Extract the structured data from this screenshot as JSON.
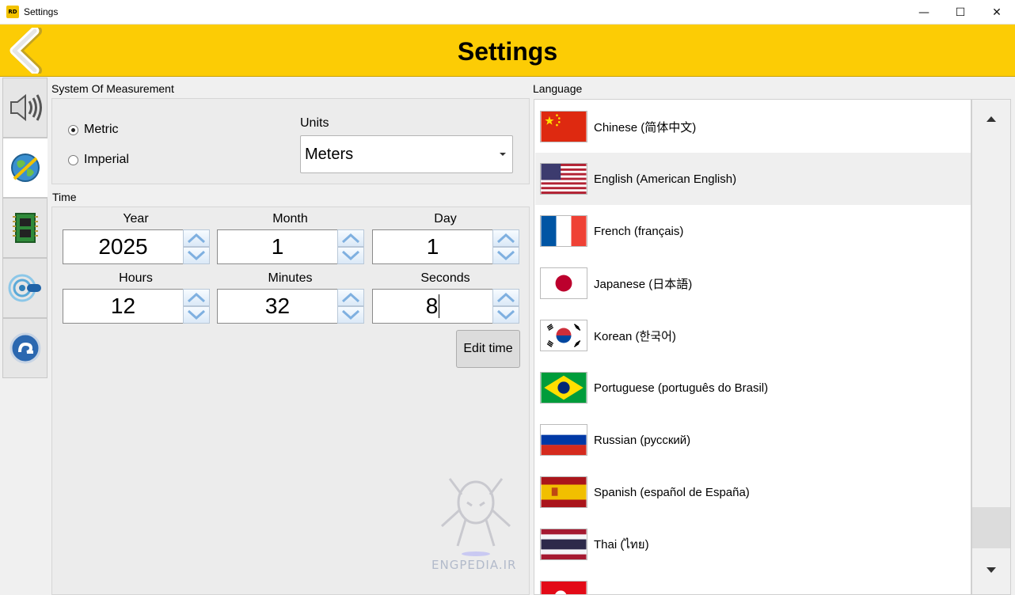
{
  "window": {
    "title": "Settings",
    "app_icon_text": "RD",
    "min_glyph": "—",
    "max_glyph": "☐",
    "close_glyph": "✕"
  },
  "header": {
    "title": "Settings"
  },
  "measurement": {
    "group_title": "System Of Measurement",
    "options": [
      {
        "label": "Metric",
        "selected": true
      },
      {
        "label": "Imperial",
        "selected": false
      }
    ],
    "units_label": "Units",
    "units_value": "Meters"
  },
  "time": {
    "group_title": "Time",
    "fields": [
      {
        "label": "Year",
        "value": "2025"
      },
      {
        "label": "Month",
        "value": "1"
      },
      {
        "label": "Day",
        "value": "1"
      },
      {
        "label": "Hours",
        "value": "12"
      },
      {
        "label": "Minutes",
        "value": "32"
      },
      {
        "label": "Seconds",
        "value": "8"
      }
    ],
    "edit_button": "Edit time"
  },
  "watermark": {
    "text": "ENGPEDIA.IR"
  },
  "language": {
    "group_title": "Language",
    "items": [
      {
        "name": "Chinese (简体中文)",
        "flag": "cn-flag-icon"
      },
      {
        "name": "English (American English)",
        "flag": "us-flag-icon",
        "selected": true
      },
      {
        "name": "French (français)",
        "flag": "fr-flag-icon"
      },
      {
        "name": "Japanese (日本語)",
        "flag": "jp-flag-icon"
      },
      {
        "name": "Korean (한국어)",
        "flag": "kr-flag-icon"
      },
      {
        "name": "Portuguese (português do Brasil)",
        "flag": "br-flag-icon"
      },
      {
        "name": "Russian (русский)",
        "flag": "ru-flag-icon"
      },
      {
        "name": "Spanish (español de España)",
        "flag": "es-flag-icon"
      },
      {
        "name": "Thai (ไทย)",
        "flag": "th-flag-icon"
      }
    ]
  },
  "colors": {
    "header": "#fccc05",
    "selected_row": "#efefef"
  }
}
